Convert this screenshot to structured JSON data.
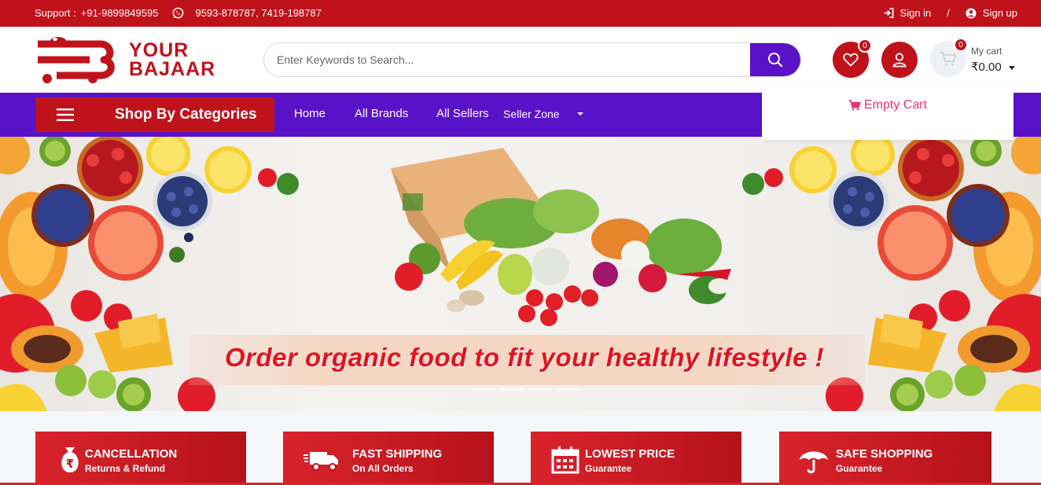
{
  "topbar": {
    "support_label": "Support :",
    "support_phone": "+91-9899849595",
    "whatsapp_numbers": "9593-878787, 7419-198787",
    "signin": "Sign in",
    "divider": "/",
    "signup": "Sign up"
  },
  "logo": {
    "line1": "YOUR",
    "line2": "BAJAAR"
  },
  "search": {
    "placeholder": "Enter Keywords to Search..."
  },
  "header": {
    "wishlist_count": "0",
    "cart_count": "0",
    "cart_label": "My cart",
    "cart_amount": "₹0.00"
  },
  "nav": {
    "categories_label": "Shop By Categories",
    "items": [
      "Home",
      "All Brands",
      "All Sellers",
      "Seller Zone"
    ]
  },
  "cart_dropdown": {
    "message": "Empty Cart"
  },
  "banner": {
    "tagline": "Order organic food to fit your healthy lifestyle !"
  },
  "features": [
    {
      "title": "CANCELLATION",
      "subtitle": "Returns & Refund",
      "icon": "rupee-bag-icon"
    },
    {
      "title": "FAST SHIPPING",
      "subtitle": "On All Orders",
      "icon": "truck-icon"
    },
    {
      "title": "LOWEST PRICE",
      "subtitle": "Guarantee",
      "icon": "calendar-icon"
    },
    {
      "title": "SAFE SHOPPING",
      "subtitle": "Guarantee",
      "icon": "umbrella-icon"
    }
  ],
  "colors": {
    "brand_red": "#c0121b",
    "brand_purple": "#5a12c8",
    "empty_cart_pink": "#e8336b"
  }
}
